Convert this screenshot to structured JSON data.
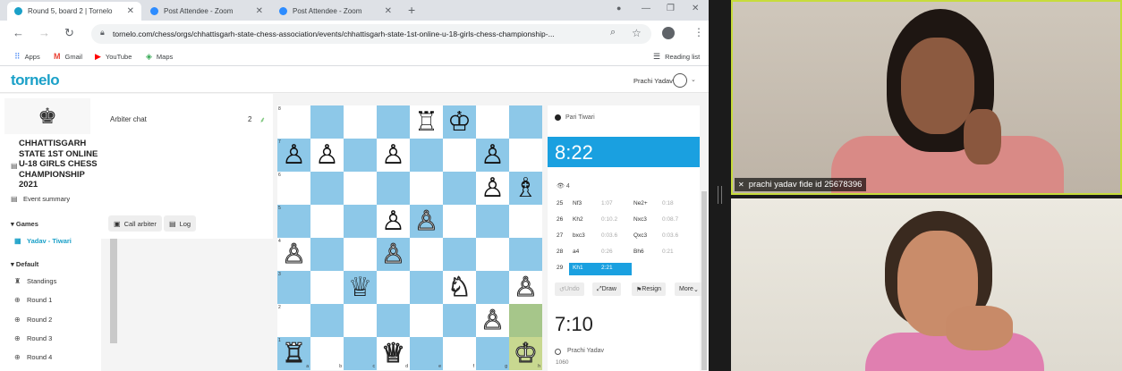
{
  "tabs": [
    {
      "title": "Round 5, board 2 | Tornelo",
      "active": true
    },
    {
      "title": "Post Attendee - Zoom",
      "active": false
    },
    {
      "title": "Post Attendee - Zoom",
      "active": false
    }
  ],
  "address_bar": {
    "url": "tornelo.com/chess/orgs/chhattisgarh-state-chess-association/events/chhattisgarh-state-1st-online-u-18-girls-chess-championship-..."
  },
  "bookmarks": {
    "items": [
      "Apps",
      "Gmail",
      "YouTube",
      "Maps"
    ],
    "reading_list": "Reading list"
  },
  "app": {
    "logo": "tornelo",
    "user_name": "Prachi Yadav"
  },
  "sidebar": {
    "event_title": "CHHATTISGARH STATE 1ST ONLINE U-18 GIRLS CHESS CHAMPIONSHIP 2021",
    "event_summary": "Event summary",
    "games_heading": "Games",
    "current_game": "Yadav - Tiwari",
    "default_heading": "Default",
    "standings": "Standings",
    "rounds": [
      "Round 1",
      "Round 2",
      "Round 3",
      "Round 4"
    ]
  },
  "chat": {
    "title": "Arbiter chat",
    "count": "2",
    "call_arbiter": "Call arbiter",
    "log": "Log"
  },
  "board": {
    "rank_labels": [
      "8",
      "7",
      "6",
      "5",
      "4",
      "3",
      "2",
      "1"
    ],
    "file_labels": [
      "a",
      "b",
      "c",
      "d",
      "e",
      "f",
      "g",
      "h"
    ],
    "rows": [
      [
        "",
        "",
        "",
        "",
        "r",
        "k",
        "",
        ""
      ],
      [
        "p",
        "p",
        "",
        "p",
        "",
        "",
        "p",
        ""
      ],
      [
        "",
        "",
        "",
        "",
        "",
        "",
        "p",
        "b"
      ],
      [
        "",
        "",
        "",
        "p",
        "P",
        "",
        "",
        ""
      ],
      [
        "P",
        "",
        "",
        "P",
        "",
        "",
        "",
        ""
      ],
      [
        "",
        "",
        "q",
        "",
        "",
        "N",
        "",
        "P"
      ],
      [
        "",
        "",
        "",
        "",
        "",
        "",
        "P",
        ""
      ],
      [
        "R",
        "",
        "",
        "Q",
        "",
        "",
        "",
        "K"
      ]
    ],
    "piece_glyphs": {
      "k": "♚",
      "q": "♛",
      "r": "♜",
      "b": "♝",
      "n": "♞",
      "p": "♟",
      "K": "♔",
      "Q": "♕",
      "R": "♖",
      "B": "♗",
      "N": "♘",
      "P": "♙"
    },
    "colors": {
      "light": "#ffffff",
      "dark": "#8dc8e8",
      "highlight": "#a6c68a"
    }
  },
  "panel": {
    "opponent_name": "Pari Tiwari",
    "opponent_clock": "8:22",
    "viewers": "4",
    "moves": [
      {
        "num": "25",
        "white": "Nf3",
        "wt": "1:07",
        "black": "Ne2+",
        "bt": "0:18"
      },
      {
        "num": "26",
        "white": "Kh2",
        "wt": "0:10.2",
        "black": "Nxc3",
        "bt": "0:08.7"
      },
      {
        "num": "27",
        "white": "bxc3",
        "wt": "0:03.6",
        "black": "Qxc3",
        "bt": "0:03.6"
      },
      {
        "num": "28",
        "white": "a4",
        "wt": "0:26",
        "black": "Bh6",
        "bt": "0:21"
      },
      {
        "num": "29",
        "white": "Kh1",
        "wt": "2:21",
        "black": "",
        "bt": ""
      }
    ],
    "undo": "Undo",
    "draw": "Draw",
    "resign": "Resign",
    "more": "More",
    "my_clock": "7:10",
    "my_name": "Prachi Yadav",
    "my_rating": "1060"
  },
  "video": {
    "top_name": "prachi yadav fide id 25678396",
    "accent": "#c7dc3c"
  }
}
